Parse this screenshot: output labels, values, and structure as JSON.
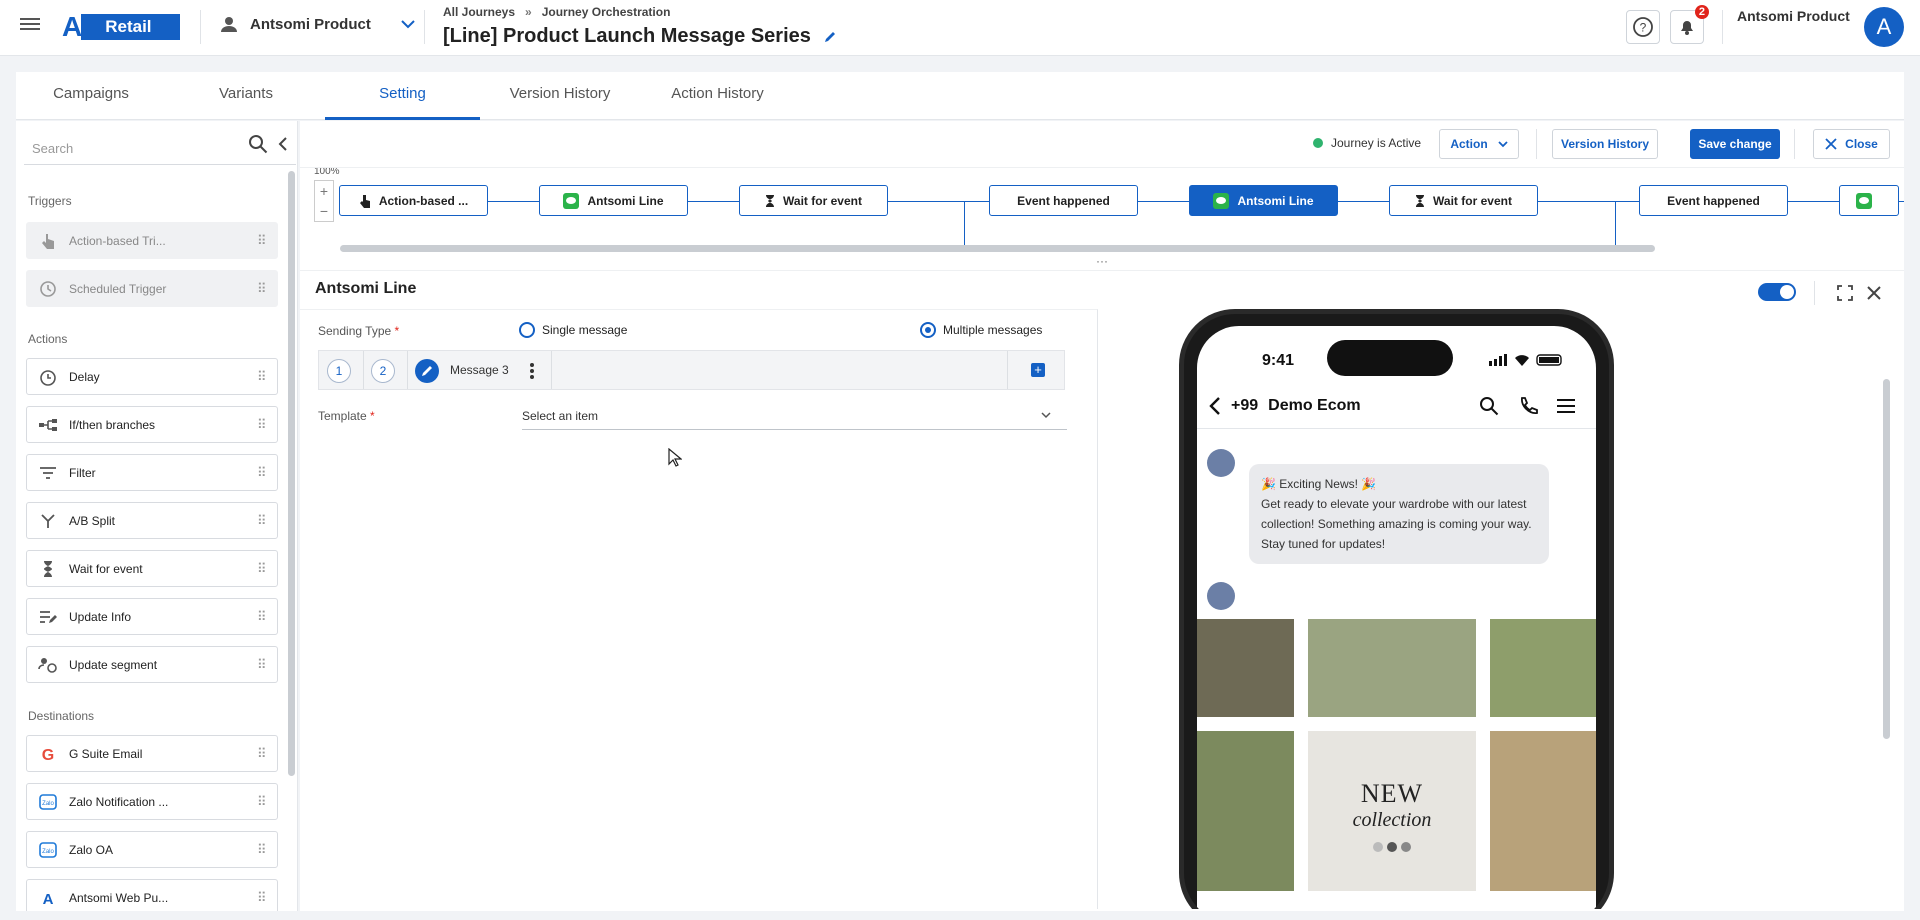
{
  "app": {
    "brand": "Retail",
    "portal": "Antsomi Product",
    "user_name": "Antsomi Product",
    "avatar_initial": "A",
    "notification_count": "2",
    "accent": "#1460c4"
  },
  "breadcrumb": {
    "items": [
      "All Journeys",
      "Journey Orchestration"
    ],
    "separator": "»"
  },
  "journey": {
    "title": "[Line] Product Launch Message Series"
  },
  "tabs": [
    {
      "label": "Campaigns"
    },
    {
      "label": "Variants"
    },
    {
      "label": "Setting"
    },
    {
      "label": "Version History"
    },
    {
      "label": "Action History"
    }
  ],
  "sidebar": {
    "search_placeholder": "Search",
    "sections": {
      "triggers": "Triggers",
      "actions": "Actions",
      "destinations": "Destinations"
    },
    "triggers": [
      {
        "label": "Action-based Tri...",
        "icon": "hand-pointer-icon"
      },
      {
        "label": "Scheduled Trigger",
        "icon": "clock-icon"
      }
    ],
    "actions": [
      {
        "label": "Delay",
        "icon": "delay-clock-icon"
      },
      {
        "label": "If/then branches",
        "icon": "branch-icon"
      },
      {
        "label": "Filter",
        "icon": "filter-icon"
      },
      {
        "label": "A/B Split",
        "icon": "split-icon"
      },
      {
        "label": "Wait for event",
        "icon": "hourglass-icon"
      },
      {
        "label": "Update Info",
        "icon": "edit-lines-icon"
      },
      {
        "label": "Update segment",
        "icon": "segment-icon"
      }
    ],
    "destinations": [
      {
        "label": "G Suite Email",
        "icon": "google-icon"
      },
      {
        "label": "Zalo Notification ...",
        "icon": "zalo-icon"
      },
      {
        "label": "Zalo OA",
        "icon": "zalo-icon"
      },
      {
        "label": "Antsomi Web Pu...",
        "icon": "antsomi-icon"
      }
    ]
  },
  "toolbar": {
    "status": "Journey is Active",
    "action_label": "Action",
    "version_history_label": "Version History",
    "save_label": "Save change",
    "close_label": "Close"
  },
  "canvas": {
    "zoom": "100%",
    "nodes": [
      {
        "label": "Action-based ...",
        "icon": "hand-pointer-icon"
      },
      {
        "label": "Antsomi Line",
        "icon": "line-icon"
      },
      {
        "label": "Wait for event",
        "icon": "hourglass-icon"
      },
      {
        "label": "Event happened",
        "icon": ""
      },
      {
        "label": "Antsomi Line",
        "icon": "line-icon",
        "selected": true
      },
      {
        "label": "Wait for event",
        "icon": "hourglass-icon"
      },
      {
        "label": "Event happened",
        "icon": ""
      }
    ]
  },
  "panel": {
    "title": "Antsomi Line",
    "sending_type_label": "Sending Type",
    "required_mark": "*",
    "options": {
      "single": "Single message",
      "multiple": "Multiple messages"
    },
    "selected_option": "multiple",
    "messages": [
      "1",
      "2"
    ],
    "current_message": "Message 3",
    "template_label": "Template",
    "template_placeholder": "Select an item"
  },
  "preview": {
    "time": "9:41",
    "chat_code": "+99",
    "chat_name": "Demo Ecom",
    "msg_title": "Exciting News!",
    "msg_body": "Get ready to elevate your wardrobe with our latest collection! Something amazing is coming your way. Stay tuned for updates!",
    "banner_line1": "NEW",
    "banner_line2": "collection"
  }
}
